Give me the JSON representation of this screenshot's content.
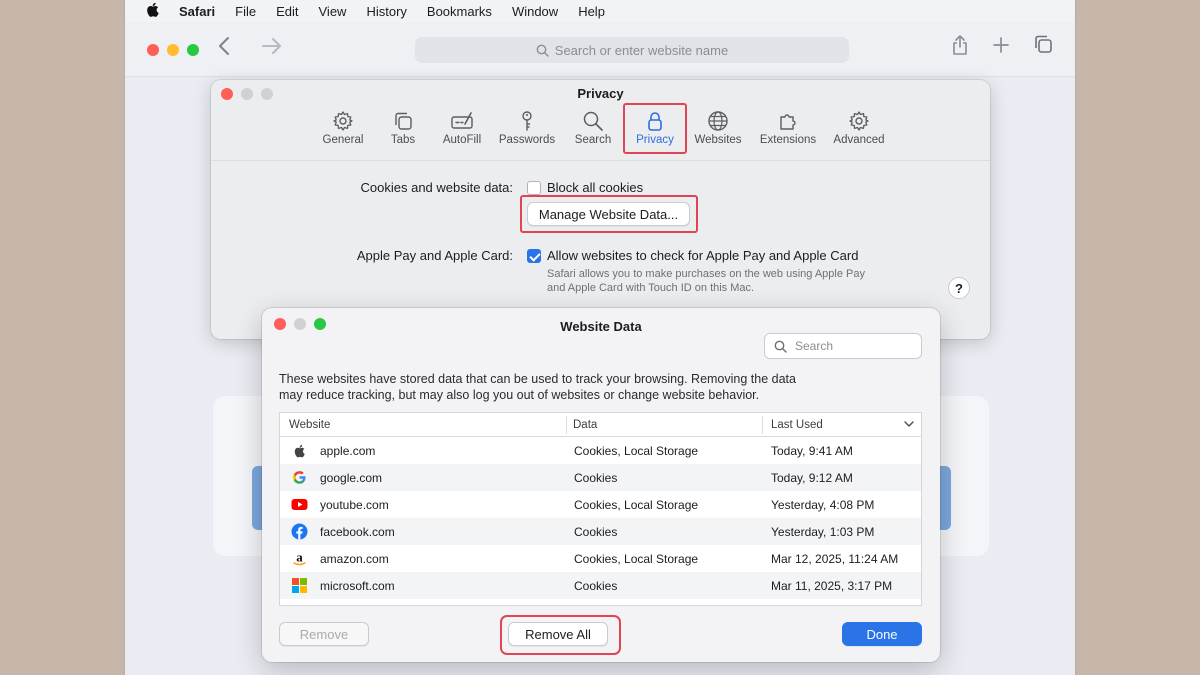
{
  "menubar": {
    "app_name": "Safari",
    "items": [
      "File",
      "Edit",
      "View",
      "History",
      "Bookmarks",
      "Window",
      "Help"
    ]
  },
  "toolbar": {
    "address_placeholder": "Search or enter website name"
  },
  "prefs": {
    "title": "Privacy",
    "tabs": [
      {
        "label": "General",
        "icon": "gear-icon"
      },
      {
        "label": "Tabs",
        "icon": "tabs-icon"
      },
      {
        "label": "AutoFill",
        "icon": "autofill-icon"
      },
      {
        "label": "Passwords",
        "icon": "key-icon"
      },
      {
        "label": "Search",
        "icon": "search-icon"
      },
      {
        "label": "Privacy",
        "icon": "lock-icon"
      },
      {
        "label": "Websites",
        "icon": "globe-icon"
      },
      {
        "label": "Extensions",
        "icon": "puzzle-icon"
      },
      {
        "label": "Advanced",
        "icon": "gear-advanced-icon"
      }
    ],
    "active_tab": "Privacy",
    "cookies_label": "Cookies and website data:",
    "block_cookies_label": "Block all cookies",
    "block_cookies_checked": false,
    "manage_button": "Manage Website Data...",
    "applepay_label": "Apple Pay and Apple Card:",
    "applepay_checkbox_label": "Allow websites to check for Apple Pay and Apple Card",
    "applepay_checked": true,
    "applepay_note_line1": "Safari allows you to make purchases on the web using Apple Pay",
    "applepay_note_line2": "and Apple Card with Touch ID on this Mac.",
    "help_label": "?"
  },
  "website_data": {
    "title": "Website Data",
    "search_placeholder": "Search",
    "description_line1": "These websites have stored data that can be used to track your browsing. Removing the data",
    "description_line2": "may reduce tracking, but may also log you out of websites or change website behavior.",
    "columns": [
      "Website",
      "Data",
      "Last Used"
    ],
    "rows": [
      {
        "site": "apple.com",
        "data": "Cookies, Local Storage",
        "last_used": "Today, 9:41 AM",
        "icon": "apple-logo-icon"
      },
      {
        "site": "google.com",
        "data": "Cookies",
        "last_used": "Today, 9:12 AM",
        "icon": "google-logo-icon"
      },
      {
        "site": "youtube.com",
        "data": "Cookies, Local Storage",
        "last_used": "Yesterday, 4:08 PM",
        "icon": "youtube-logo-icon"
      },
      {
        "site": "facebook.com",
        "data": "Cookies",
        "last_used": "Yesterday, 1:03 PM",
        "icon": "facebook-logo-icon"
      },
      {
        "site": "amazon.com",
        "data": "Cookies, Local Storage",
        "last_used": "Mar 12, 2025, 11:24 AM",
        "icon": "amazon-logo-icon"
      },
      {
        "site": "microsoft.com",
        "data": "Cookies",
        "last_used": "Mar 11, 2025, 3:17 PM",
        "icon": "microsoft-logo-icon"
      }
    ],
    "remove_button": "Remove",
    "remove_all_button": "Remove All",
    "done_button": "Done"
  },
  "colors": {
    "accent": "#2a74e8",
    "highlight": "#e04555"
  }
}
